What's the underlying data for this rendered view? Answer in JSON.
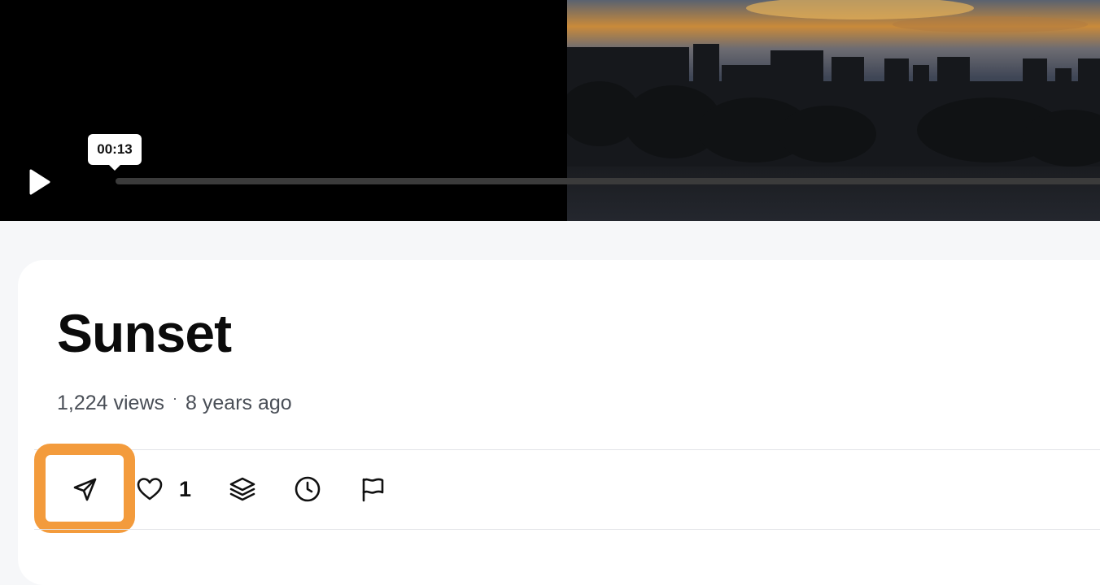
{
  "player": {
    "play_icon": "play-icon",
    "tooltip_time": "00:13",
    "progress_fraction": 0.0
  },
  "video": {
    "title": "Sunset",
    "views": "1,224 views",
    "separator": "·",
    "age": "8 years ago"
  },
  "actions": {
    "share_icon": "send-icon",
    "like_icon": "heart-icon",
    "like_count": "1",
    "collect_icon": "layers-icon",
    "watch_later_icon": "clock-icon",
    "report_icon": "flag-icon"
  },
  "colors": {
    "highlight": "#f39b3c",
    "card_background": "#ffffff",
    "page_background": "#f6f7f9"
  }
}
